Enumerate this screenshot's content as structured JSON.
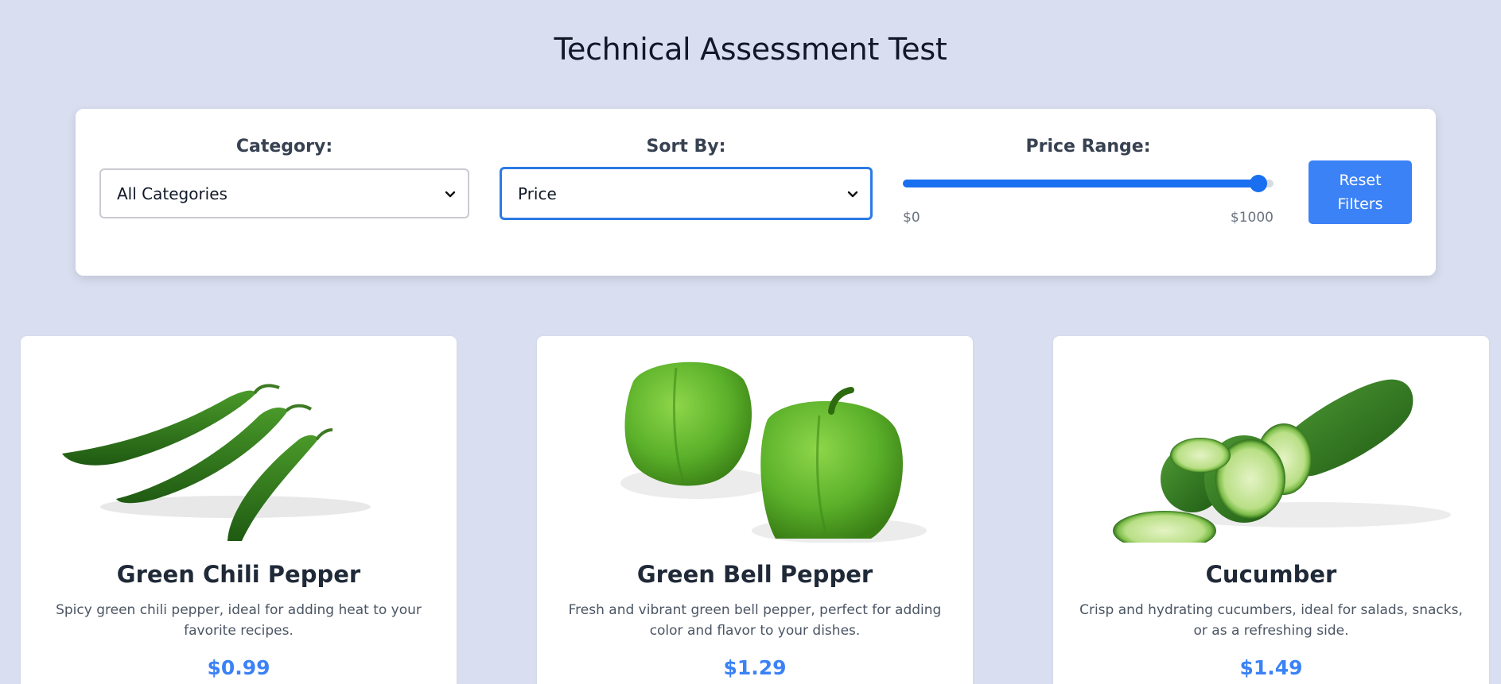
{
  "page": {
    "title": "Technical Assessment Test"
  },
  "filters": {
    "category": {
      "label": "Category:",
      "selected": "All Categories"
    },
    "sort": {
      "label": "Sort By:",
      "selected": "Price"
    },
    "price_range": {
      "label": "Price Range:",
      "min_label": "$0",
      "max_label": "$1000",
      "value_fraction": 0.96
    },
    "reset_label": "Reset Filters"
  },
  "colors": {
    "accent": "#3b82f6",
    "background": "#d9dff0",
    "price": "#3b82f6"
  },
  "products": [
    {
      "name": "Green Chili Pepper",
      "description": "Spicy green chili pepper, ideal for adding heat to your favorite recipes.",
      "price": "$0.99",
      "image_icon": "green-chili-pepper-image"
    },
    {
      "name": "Green Bell Pepper",
      "description": "Fresh and vibrant green bell pepper, perfect for adding color and flavor to your dishes.",
      "price": "$1.29",
      "image_icon": "green-bell-pepper-image"
    },
    {
      "name": "Cucumber",
      "description": "Crisp and hydrating cucumbers, ideal for salads, snacks, or as a refreshing side.",
      "price": "$1.49",
      "image_icon": "cucumber-image"
    }
  ]
}
